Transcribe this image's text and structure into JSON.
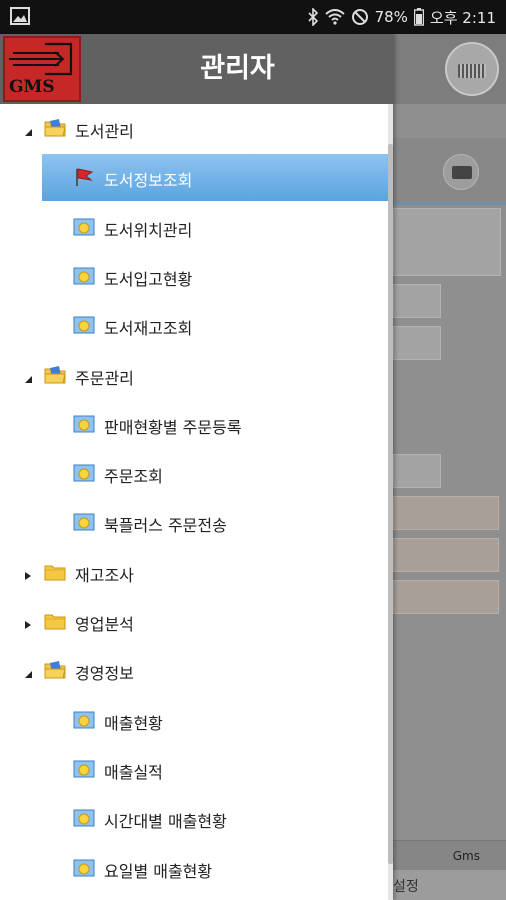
{
  "status_bar": {
    "battery": "78%",
    "time": "오후 2:11",
    "icons": [
      "gallery-icon",
      "bluetooth-icon",
      "wifi-icon",
      "dnd-icon",
      "battery-icon"
    ]
  },
  "drawer": {
    "title": "관리자",
    "logo_text": "GMS",
    "tree": [
      {
        "label": "도서관리",
        "level": 0,
        "expanded": true
      },
      {
        "label": "도서정보조회",
        "level": 1,
        "selected": true
      },
      {
        "label": "도서위치관리",
        "level": 1
      },
      {
        "label": "도서입고현황",
        "level": 1
      },
      {
        "label": "도서재고조회",
        "level": 1
      },
      {
        "label": "주문관리",
        "level": 0,
        "expanded": true
      },
      {
        "label": "판매현황별 주문등록",
        "level": 1
      },
      {
        "label": "주문조회",
        "level": 1
      },
      {
        "label": "북플러스 주문전송",
        "level": 1
      },
      {
        "label": "재고조사",
        "level": 0,
        "expanded": false
      },
      {
        "label": "영업분석",
        "level": 0,
        "expanded": false
      },
      {
        "label": "경영정보",
        "level": 0,
        "expanded": true
      },
      {
        "label": "매출현황",
        "level": 1
      },
      {
        "label": "매출실적",
        "level": 1
      },
      {
        "label": "시간대별 매출현황",
        "level": 1
      },
      {
        "label": "요일별 매출현황",
        "level": 1
      }
    ]
  },
  "background_app": {
    "tab_label": "Gms",
    "setting_label": "설정"
  },
  "colors": {
    "header": "#616161",
    "selected": "#5aa4e0",
    "logo": "#c62828"
  }
}
